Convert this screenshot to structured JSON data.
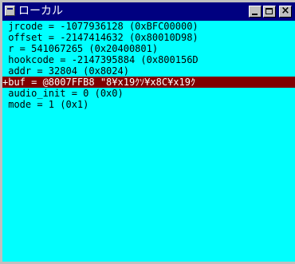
{
  "window": {
    "title": "ローカル"
  },
  "title_buttons": {
    "minimize": "",
    "maximize": "",
    "close": "×"
  },
  "variables": [
    " jrcode = -1077936128 (0xBFC00000)",
    " offset = -2147414632 (0x80010D98)",
    " r = 541067265 (0x20400801)",
    " hookcode = -2147395884 (0x800156D",
    " addr = 32804 (0x8024)",
    "+buf = @8007FFB8 \"8¥x19ｸｿ¥x8C¥x19ｸ",
    " audio_init = 0 (0x0)",
    " mode = 1 (0x1)"
  ],
  "selected_index": 5,
  "colors": {
    "titlebar": "#000080",
    "content_bg": "#00ffff",
    "selection_bg": "#800000",
    "chrome": "#c0c0c0"
  }
}
